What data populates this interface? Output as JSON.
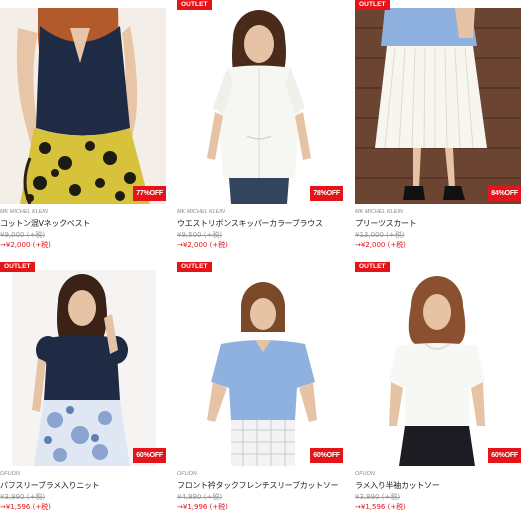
{
  "products": [
    {
      "outlet": "",
      "discount": "77%OFF",
      "brand": "MK MICHEL KLEIN",
      "name": "コットン混Vネックベスト",
      "old_price": "¥9,000 (+税)",
      "new_price": "→¥2,000 (+税)"
    },
    {
      "outlet": "OUTLET",
      "discount": "78%OFF",
      "brand": "MK MICHEL KLEIN",
      "name": "ウエストリボンスキッパーカラーブラウス",
      "old_price": "¥9,500 (+税)",
      "new_price": "→¥2,000 (+税)"
    },
    {
      "outlet": "OUTLET",
      "discount": "84%OFF",
      "brand": "MK MICHEL KLEIN",
      "name": "プリーツスカート",
      "old_price": "¥13,000 (+税)",
      "new_price": "→¥2,000 (+税)"
    },
    {
      "outlet": "OUTLET",
      "discount": "60%OFF",
      "brand": "OFUON",
      "name": "パフスリーブラメ入りニット",
      "old_price": "¥3,990 (+税)",
      "new_price": "→¥1,596 (+税)"
    },
    {
      "outlet": "OUTLET",
      "discount": "60%OFF",
      "brand": "OFUON",
      "name": "フロント衿タックフレンチスリーブカットソー",
      "old_price": "¥4,990 (+税)",
      "new_price": "→¥1,996 (+税)"
    },
    {
      "outlet": "OUTLET",
      "discount": "60%OFF",
      "brand": "OFUON",
      "name": "ラメ入り半袖カットソー",
      "old_price": "¥3,990 (+税)",
      "new_price": "→¥1,596 (+税)"
    }
  ],
  "colors": {
    "accent": "#e4141b",
    "brand_text": "#888888",
    "price_old": "#999999",
    "price_new": "#e4141b"
  },
  "icons": {
    "photo": "product-photo"
  }
}
